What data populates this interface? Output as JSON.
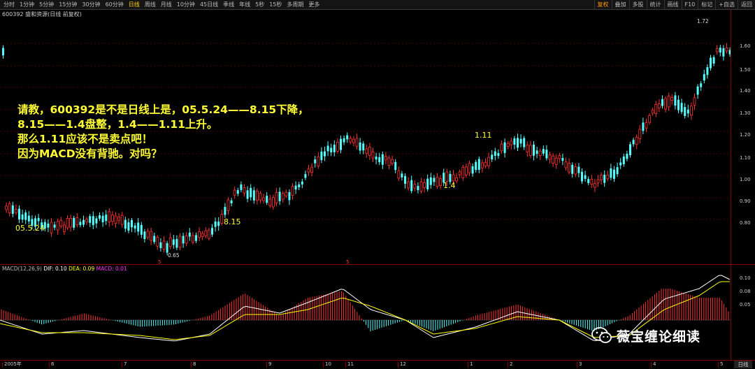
{
  "toolbar": {
    "periods": [
      "分时",
      "1分钟",
      "5分钟",
      "15分钟",
      "30分钟",
      "60分钟",
      "日线",
      "周线",
      "月线",
      "10分钟",
      "45日线",
      "季线",
      "年线",
      "5秒",
      "15秒",
      "多周期",
      "更多"
    ],
    "active_period": "日线",
    "right_buttons": [
      "复权",
      "叠加",
      "多股",
      "统计",
      "画线",
      "F10",
      "标记",
      "+自选",
      "返回"
    ],
    "active_right": "复权"
  },
  "title": "600392 盛和资源(日线 前复权)",
  "price_axis": [
    "1.60",
    "1.50",
    "1.40",
    "1.30",
    "1.20",
    "1.10",
    "1.00",
    "0.90",
    "0.80"
  ],
  "price_ann": {
    "high": "1.72",
    "low": "0.65"
  },
  "question": {
    "line1": "请教，600392是不是日线上是，05.5.24——8.15下降，",
    "line2": "8.15——1.4盘整，1.4——1.11上升。",
    "line3": "那么1.11应该不是卖点吧！",
    "line4": "因为MACD没有背驰。对吗？"
  },
  "annotations": {
    "a1": "05.5.24",
    "a2": "8.15",
    "a3": "1.4",
    "a4": "1.11"
  },
  "macd": {
    "label": "MACD(12,26,9)",
    "dif": "DIF: 0.10",
    "dea": "DEA: 0.09",
    "macd": "MACD: 0.01",
    "axis": [
      "0.10",
      "0.08",
      "0.05"
    ]
  },
  "x_axis": [
    "2005年",
    "6",
    "7",
    "8",
    "9",
    "10",
    "11",
    "12",
    "1",
    "2",
    "3",
    "4",
    "5"
  ],
  "day_button": "日线",
  "marks": {
    "m1": "5",
    "m2": "5"
  },
  "watermark": "薇宝缠论细读",
  "colors": {
    "up": "#ff3333",
    "down": "#54ffff",
    "dif": "#ffffff",
    "dea": "#ffff00",
    "accent": "#ffff33"
  }
}
